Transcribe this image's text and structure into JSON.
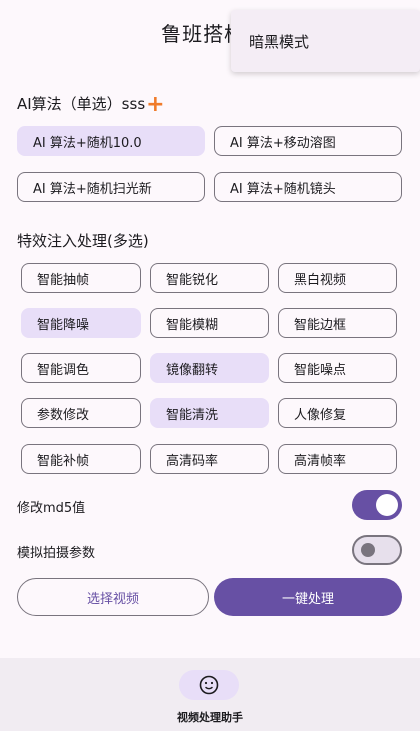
{
  "app": {
    "title": "鲁班搭档S"
  },
  "menu": {
    "items": [
      "暗黑模式"
    ]
  },
  "algo": {
    "label": "AI算法（单选）sss",
    "options": [
      {
        "label": "AI 算法+随机10.0",
        "selected": true
      },
      {
        "label": "AI 算法+移动溶图",
        "selected": false
      },
      {
        "label": "AI 算法+随机扫光新",
        "selected": false
      },
      {
        "label": "AI 算法+随机镜头",
        "selected": false
      }
    ]
  },
  "effects": {
    "label": "特效注入处理(多选)",
    "options": [
      {
        "label": "智能抽帧",
        "selected": false
      },
      {
        "label": "智能锐化",
        "selected": false
      },
      {
        "label": "黑白视频",
        "selected": false
      },
      {
        "label": "智能降噪",
        "selected": true
      },
      {
        "label": "智能模糊",
        "selected": false
      },
      {
        "label": "智能边框",
        "selected": false
      },
      {
        "label": "智能调色",
        "selected": false
      },
      {
        "label": "镜像翻转",
        "selected": true
      },
      {
        "label": "智能噪点",
        "selected": false
      },
      {
        "label": "参数修改",
        "selected": false
      },
      {
        "label": "智能清洗",
        "selected": true
      },
      {
        "label": "人像修复",
        "selected": false
      },
      {
        "label": "智能补帧",
        "selected": false
      },
      {
        "label": "高清码率",
        "selected": false
      },
      {
        "label": "高清帧率",
        "selected": false
      }
    ]
  },
  "toggles": [
    {
      "label": "修改md5值",
      "on": true
    },
    {
      "label": "模拟拍摄参数",
      "on": false
    }
  ],
  "actions": {
    "select_video": "选择视频",
    "process": "一键处理"
  },
  "nav": {
    "label": "视频处理助手",
    "icon": "smiley-icon"
  },
  "colors": {
    "accent": "#6750a4",
    "selected_chip": "#e8def8",
    "plus": "#f07b2a"
  }
}
